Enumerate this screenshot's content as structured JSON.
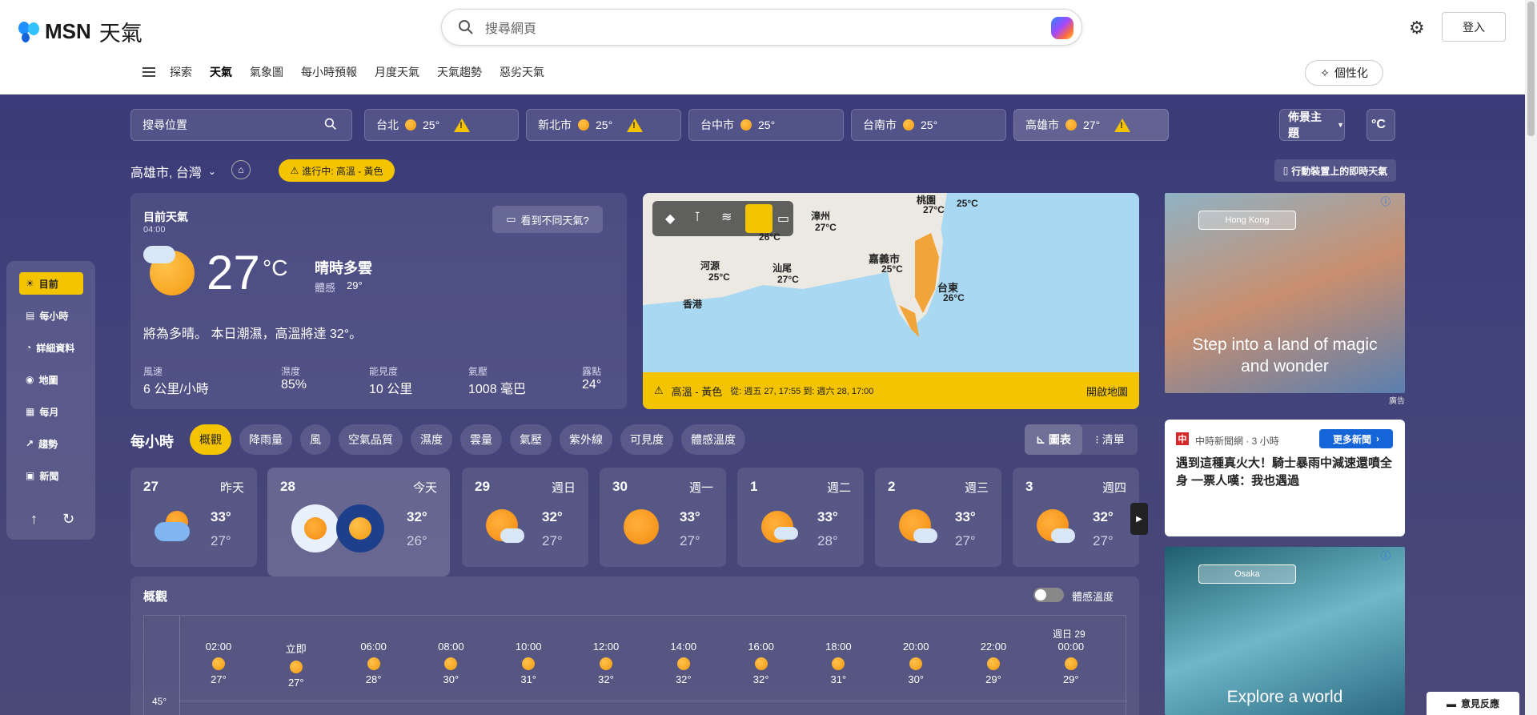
{
  "header": {
    "logo": "MSN",
    "logo_suffix": "天氣",
    "search_placeholder": "搜尋網頁",
    "login": "登入",
    "personalize": "個性化"
  },
  "nav": [
    {
      "label": "探索"
    },
    {
      "label": "天氣",
      "active": true
    },
    {
      "label": "氣象圖"
    },
    {
      "label": "每小時預報"
    },
    {
      "label": "月度天氣"
    },
    {
      "label": "天氣趨勢"
    },
    {
      "label": "惡劣天氣"
    }
  ],
  "locbar": {
    "search_placeholder": "搜尋位置",
    "theme": "佈景主題",
    "unit": "°C",
    "cities": [
      {
        "name": "台北",
        "temp": "25°",
        "warn": true
      },
      {
        "name": "新北市",
        "temp": "25°",
        "warn": true
      },
      {
        "name": "台中市",
        "temp": "25°",
        "warn": false
      },
      {
        "name": "台南市",
        "temp": "25°",
        "warn": false
      },
      {
        "name": "高雄市",
        "temp": "27°",
        "warn": true
      }
    ]
  },
  "location": {
    "name": "高雄市, 台灣",
    "alert": "進行中: 高溫 - 黃色",
    "mobile": "行動裝置上的即時天氣"
  },
  "current": {
    "title": "目前天氣",
    "time": "04:00",
    "feedback": "看到不同天氣?",
    "temp": "27",
    "unit": "°C",
    "condition": "晴時多雲",
    "feels_label": "體感",
    "feels": "29°",
    "summary": "將為多晴。 本日潮濕，高溫將達 32°。",
    "metrics": [
      {
        "label": "風速",
        "value": "6 公里/小時"
      },
      {
        "label": "濕度",
        "value": "85%"
      },
      {
        "label": "能見度",
        "value": "10 公里"
      },
      {
        "label": "氣壓",
        "value": "1008 毫巴"
      },
      {
        "label": "露點",
        "value": "24°"
      }
    ]
  },
  "map": {
    "places": [
      {
        "name": "桃園",
        "temp": "27°C"
      },
      {
        "name": "",
        "temp": "25°C"
      },
      {
        "name": "漳州",
        "temp": "27°C"
      },
      {
        "name": "",
        "temp": "26°C"
      },
      {
        "name": "河源",
        "temp": "25°C"
      },
      {
        "name": "汕尾",
        "temp": "27°C"
      },
      {
        "name": "嘉義市",
        "temp": "25°C"
      },
      {
        "name": "台東",
        "temp": "26°C"
      },
      {
        "name": "香港",
        "temp": ""
      }
    ],
    "alert_label": "高溫 - 黃色",
    "alert_time": "從: 週五 27, 17:55 到: 週六 28, 17:00",
    "open": "開啟地圖"
  },
  "sidebar": [
    {
      "label": "目前",
      "active": true
    },
    {
      "label": "每小時"
    },
    {
      "label": "詳細資料"
    },
    {
      "label": "地圖"
    },
    {
      "label": "每月"
    },
    {
      "label": "趨勢"
    },
    {
      "label": "新聞"
    }
  ],
  "hourly": {
    "title": "每小時",
    "tabs": [
      "概觀",
      "降雨量",
      "風",
      "空氣品質",
      "濕度",
      "雲量",
      "氣壓",
      "紫外線",
      "可見度",
      "體感溫度"
    ],
    "view_chart": "圖表",
    "view_list": "清單"
  },
  "days": [
    {
      "num": "27",
      "name": "昨天",
      "hi": "33°",
      "lo": "27°"
    },
    {
      "num": "28",
      "name": "今天",
      "hi": "32°",
      "lo": "26°"
    },
    {
      "num": "29",
      "name": "週日",
      "hi": "32°",
      "lo": "27°"
    },
    {
      "num": "30",
      "name": "週一",
      "hi": "33°",
      "lo": "27°"
    },
    {
      "num": "1",
      "name": "週二",
      "hi": "33°",
      "lo": "28°"
    },
    {
      "num": "2",
      "name": "週三",
      "hi": "33°",
      "lo": "27°"
    },
    {
      "num": "3",
      "name": "週四",
      "hi": "32°",
      "lo": "27°"
    }
  ],
  "overview": {
    "title": "概觀",
    "feels_toggle": "體感溫度",
    "yaxis_top": "45°",
    "day_marker": "週日 29",
    "hours": [
      {
        "t": "02:00",
        "v": "27°"
      },
      {
        "t": "立即",
        "v": "27°"
      },
      {
        "t": "06:00",
        "v": "28°"
      },
      {
        "t": "08:00",
        "v": "30°"
      },
      {
        "t": "10:00",
        "v": "31°"
      },
      {
        "t": "12:00",
        "v": "32°"
      },
      {
        "t": "14:00",
        "v": "32°"
      },
      {
        "t": "16:00",
        "v": "32°"
      },
      {
        "t": "18:00",
        "v": "31°"
      },
      {
        "t": "20:00",
        "v": "30°"
      },
      {
        "t": "22:00",
        "v": "29°"
      },
      {
        "t": "00:00",
        "v": "29°"
      }
    ]
  },
  "ads": {
    "ad1_tag": "Hong Kong",
    "ad1_text": "Step into a land of magic and wonder",
    "ad_label": "廣告",
    "ad2_tag": "Osaka",
    "ad2_text": "Explore a world"
  },
  "news": {
    "source": "中時新聞網 · 3 小時",
    "more": "更多新聞",
    "headline": "遇到這種真火大！騎士暴雨中減速還噴全身 一票人嘆：我也遇過"
  },
  "feedback_btn": "意見反應"
}
